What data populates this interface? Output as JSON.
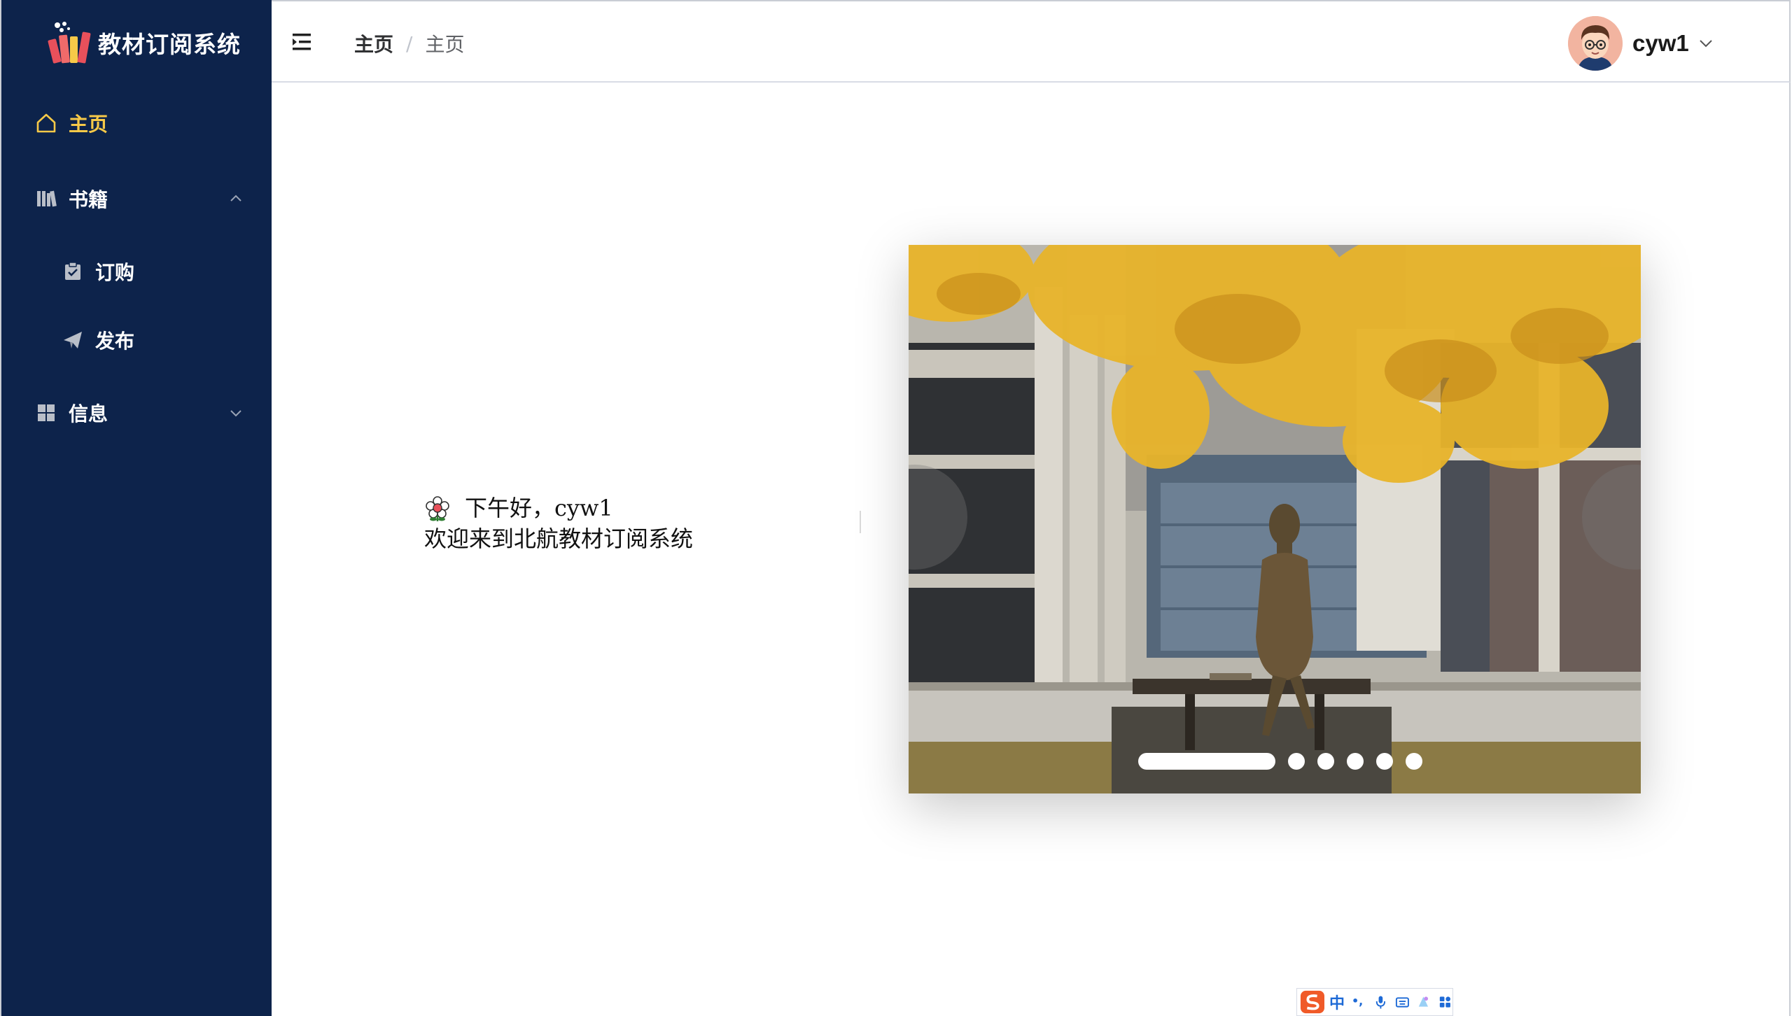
{
  "app": {
    "title": "教材订阅系统"
  },
  "sidebar": {
    "items": [
      {
        "label": "主页",
        "icon": "home-icon",
        "active": true
      },
      {
        "label": "书籍",
        "icon": "books-icon",
        "expanded": true,
        "children": [
          {
            "label": "订购",
            "icon": "clipboard-check-icon"
          },
          {
            "label": "发布",
            "icon": "paper-plane-icon"
          }
        ]
      },
      {
        "label": "信息",
        "icon": "grid-icon",
        "expanded": false
      }
    ]
  },
  "header": {
    "breadcrumb": [
      "主页",
      "主页"
    ],
    "breadcrumb_separator": "/",
    "user": {
      "name": "cyw1"
    }
  },
  "main": {
    "greeting_line1": "下午好，cyw1",
    "greeting_line2": "欢迎来到北航教材订阅系统",
    "carousel": {
      "slide_count": 6,
      "active_index": 0
    }
  },
  "ime": {
    "mode_label": "中",
    "punct_label": "•,"
  },
  "colors": {
    "sidebar_bg": "#0d234b",
    "active_menu": "#f7c948",
    "header_border": "#d8dce5"
  }
}
